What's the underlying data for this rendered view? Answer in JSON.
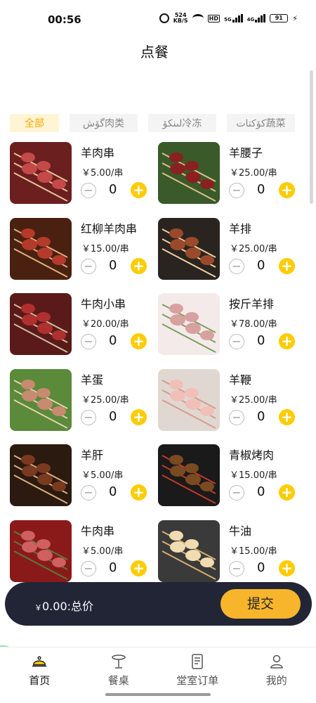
{
  "status": {
    "time": "00:56",
    "net_speed_value": "524",
    "net_speed_unit": "KB/S",
    "hd_label": "HD",
    "signal_1": "5G",
    "signal_2": "4G",
    "battery": "91"
  },
  "header": {
    "title": "点餐"
  },
  "tabs": [
    {
      "label": "全部",
      "active": true
    },
    {
      "label": "گۆش肉类"
    },
    {
      "label": "لىنكۆ冷冻"
    },
    {
      "label": "كۆكتات蔬菜"
    }
  ],
  "items": [
    {
      "name": "羊肉串",
      "price": "5.00",
      "unit": "/串",
      "qty": "0",
      "currency": "￥"
    },
    {
      "name": "羊腰子",
      "price": "25.00",
      "unit": "/串",
      "qty": "0",
      "currency": "￥"
    },
    {
      "name": "红柳羊肉串",
      "price": "15.00",
      "unit": "/串",
      "qty": "0",
      "currency": "￥"
    },
    {
      "name": "羊排",
      "price": "25.00",
      "unit": "/串",
      "qty": "0",
      "currency": "￥"
    },
    {
      "name": "牛肉小串",
      "price": "20.00",
      "unit": "/串",
      "qty": "0",
      "currency": "￥"
    },
    {
      "name": "按斤羊排",
      "price": "78.00",
      "unit": "/串",
      "qty": "0",
      "currency": "￥"
    },
    {
      "name": "羊蛋",
      "price": "25.00",
      "unit": "/串",
      "qty": "0",
      "currency": "￥"
    },
    {
      "name": "羊鞭",
      "price": "25.00",
      "unit": "/串",
      "qty": "0",
      "currency": "￥"
    },
    {
      "name": "羊肝",
      "price": "5.00",
      "unit": "/串",
      "qty": "0",
      "currency": "￥"
    },
    {
      "name": "青椒烤肉",
      "price": "15.00",
      "unit": "/串",
      "qty": "0",
      "currency": "￥"
    },
    {
      "name": "牛肉串",
      "price": "5.00",
      "unit": "/串",
      "qty": "0",
      "currency": "￥"
    },
    {
      "name": "牛油",
      "price": "15.00",
      "unit": "/串",
      "qty": "0",
      "currency": "￥"
    }
  ],
  "cart": {
    "currency": "￥",
    "total": "0.00:总价",
    "submit_label": "提交"
  },
  "nav": [
    {
      "label": "首页",
      "icon": "chef-hat-icon",
      "active": true
    },
    {
      "label": "餐桌",
      "icon": "table-icon"
    },
    {
      "label": "堂室订单",
      "icon": "order-list-icon"
    },
    {
      "label": "我的",
      "icon": "user-icon"
    }
  ],
  "colors": {
    "accent": "#ffcc00",
    "submit": "#f6b52b",
    "cart_bar": "#222536",
    "tab_active_text": "#f5a800"
  }
}
